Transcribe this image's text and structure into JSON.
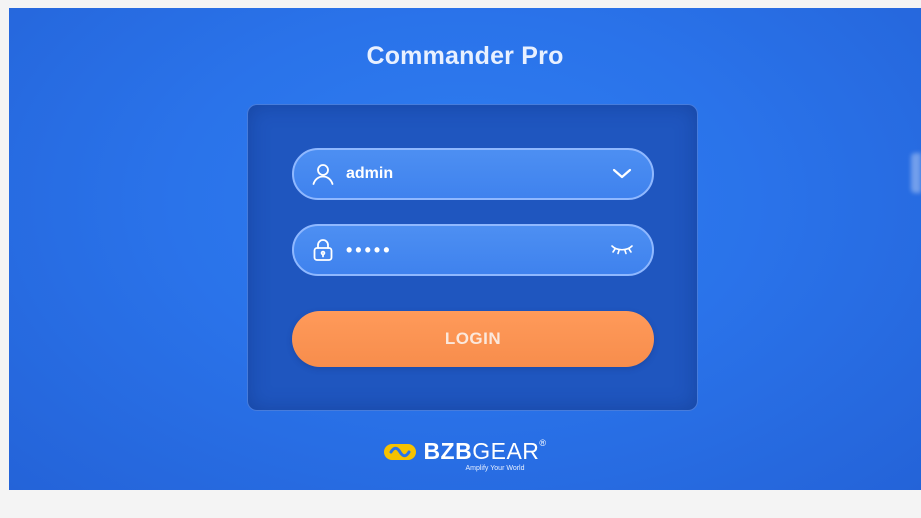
{
  "app": {
    "title": "Commander Pro"
  },
  "login_form": {
    "username_value": "admin",
    "password_masked": "•••••",
    "login_label": "LOGIN"
  },
  "brand": {
    "name_bold": "BZB",
    "name_light": "GEAR",
    "registered_mark": "®",
    "tagline": "Amplify Your World"
  },
  "icons": {
    "user": "user-icon",
    "dropdown": "chevron-down-icon",
    "lock": "lock-icon",
    "password_toggle": "eye-closed-icon",
    "logo": "bzbgear-logo-icon"
  },
  "colors": {
    "background": "#2a73ea",
    "panel": "#1f56bf",
    "field": "#4487ef",
    "field_border": "#8fb8ff",
    "login_button": "#f98f4f",
    "logo_yellow": "#f6c200"
  }
}
